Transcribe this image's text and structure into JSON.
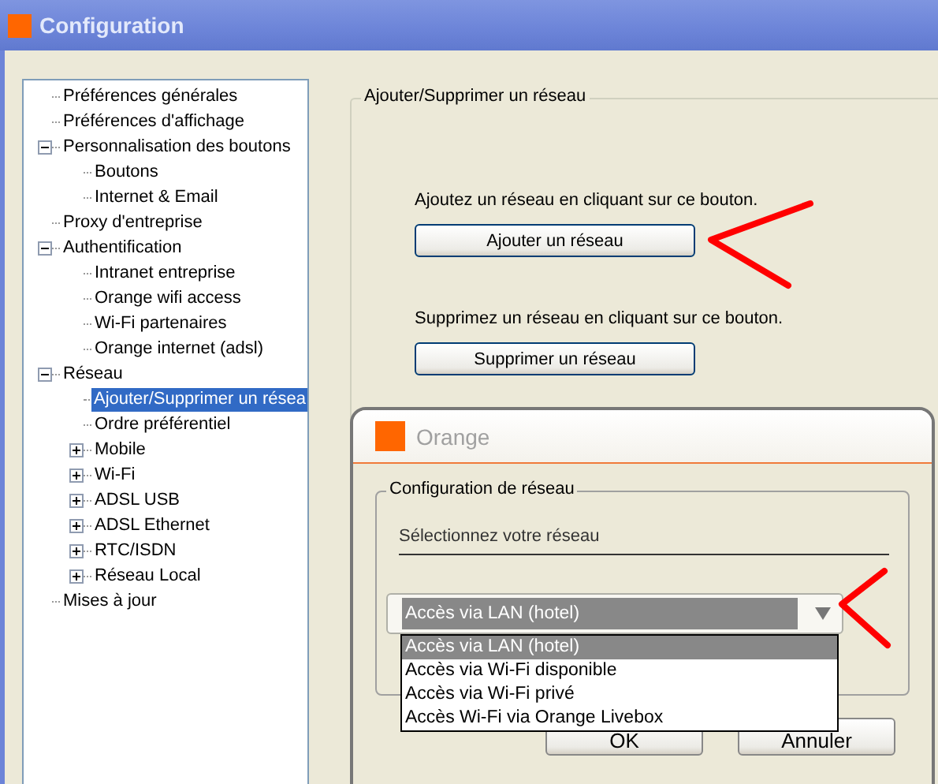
{
  "window": {
    "title": "Configuration"
  },
  "tree": [
    {
      "label": "Préférences générales",
      "selected": false
    },
    {
      "label": "Préférences d'affichage",
      "selected": false
    },
    {
      "label": "Personnalisation des boutons",
      "selected": false,
      "expanded": true,
      "children": [
        {
          "label": "Boutons",
          "selected": false
        },
        {
          "label": "Internet & Email",
          "selected": false
        }
      ]
    },
    {
      "label": "Proxy d'entreprise",
      "selected": false
    },
    {
      "label": "Authentification",
      "selected": false,
      "expanded": true,
      "children": [
        {
          "label": "Intranet entreprise",
          "selected": false
        },
        {
          "label": "Orange wifi access",
          "selected": false
        },
        {
          "label": "Wi-Fi partenaires",
          "selected": false
        },
        {
          "label": "Orange internet (adsl)",
          "selected": false
        }
      ]
    },
    {
      "label": "Réseau",
      "selected": false,
      "expanded": true,
      "children": [
        {
          "label": "Ajouter/Supprimer un résea",
          "selected": true
        },
        {
          "label": "Ordre préférentiel",
          "selected": false
        },
        {
          "label": "Mobile",
          "selected": false,
          "expanded": false
        },
        {
          "label": "Wi-Fi",
          "selected": false,
          "expanded": false
        },
        {
          "label": "ADSL USB",
          "selected": false,
          "expanded": false
        },
        {
          "label": "ADSL Ethernet",
          "selected": false,
          "expanded": false
        },
        {
          "label": "RTC/ISDN",
          "selected": false,
          "expanded": false
        },
        {
          "label": "Réseau Local",
          "selected": false,
          "expanded": false
        }
      ]
    },
    {
      "label": "Mises à jour",
      "selected": false
    }
  ],
  "section": {
    "title": "Ajouter/Supprimer un réseau",
    "add_text": "Ajoutez un réseau en cliquant sur ce bouton.",
    "add_button": "Ajouter un réseau",
    "remove_text": "Supprimez un réseau en cliquant sur ce bouton.",
    "remove_button": "Supprimer un réseau"
  },
  "dialog": {
    "title": "Orange",
    "group_title": "Configuration de réseau",
    "prompt": "Sélectionnez votre réseau",
    "combo": {
      "value": "Accès via LAN (hotel)",
      "open": true,
      "options": [
        {
          "label": "Accès via LAN (hotel)",
          "selected": true
        },
        {
          "label": "Accès via Wi-Fi disponible",
          "selected": false
        },
        {
          "label": "Accès via Wi-Fi privé",
          "selected": false
        },
        {
          "label": "Accès Wi-Fi via Orange Livebox",
          "selected": false
        }
      ]
    },
    "buttons": [
      "OK",
      "Annuler"
    ]
  }
}
